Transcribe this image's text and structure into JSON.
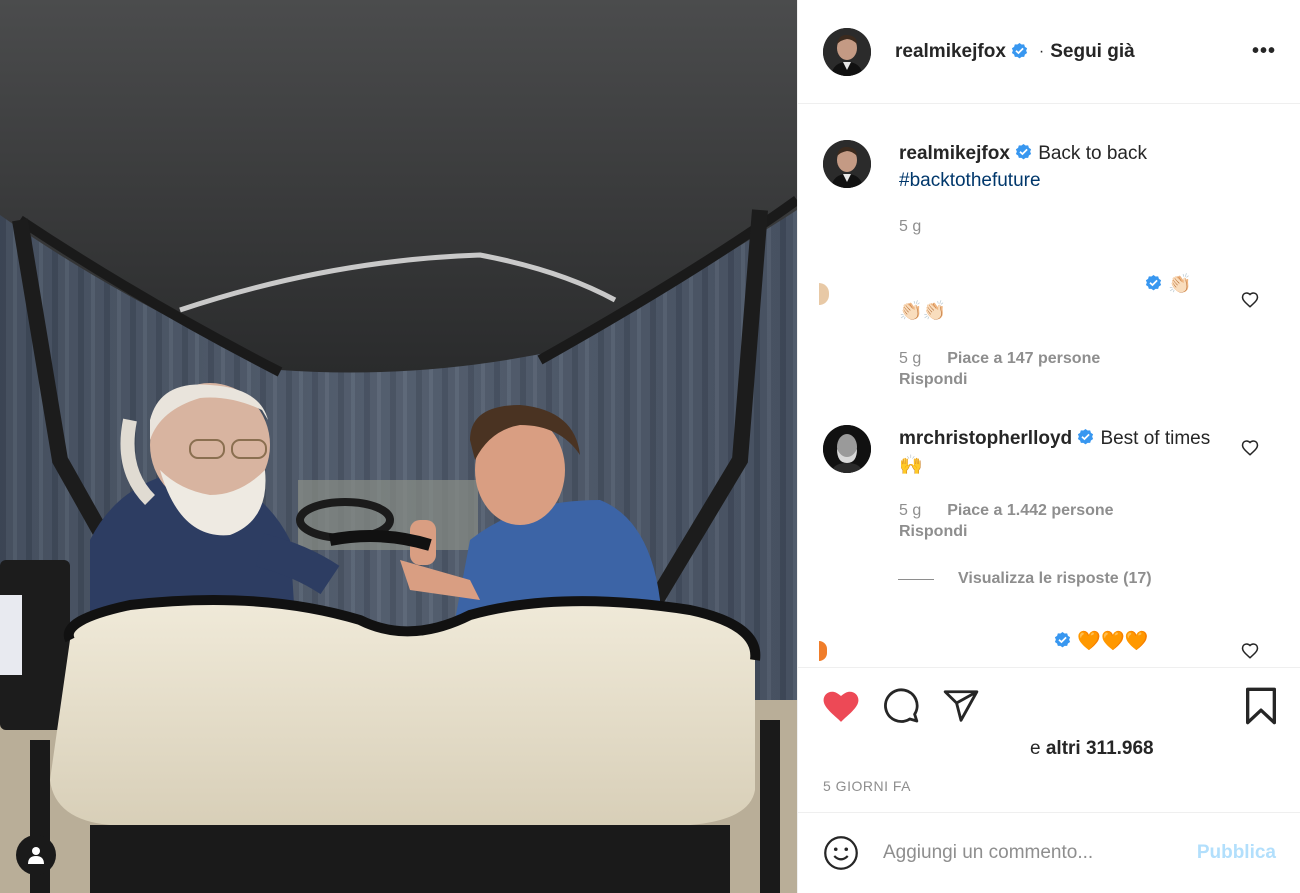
{
  "post": {
    "author": "realmikejfox",
    "follow_status": "Segui già",
    "dot": "·",
    "more": "•••"
  },
  "caption": {
    "username": "realmikejfox",
    "text": "Back to back",
    "hashtag": "#backtothefuture",
    "age": "5 g"
  },
  "comments": [
    {
      "username": "",
      "text": "👏🏻 👏🏻👏🏻",
      "age": "5 g",
      "likes": "Piace a 147 persone",
      "reply": "Rispondi"
    },
    {
      "username": "mrchristopherlloyd",
      "text": "Best of times 🙌",
      "age": "5 g",
      "likes": "Piace a 1.442 persone",
      "reply": "Rispondi",
      "view_replies": "Visualizza le risposte (17)"
    },
    {
      "username": "",
      "text": "🧡🧡🧡"
    }
  ],
  "actions": {
    "liked": true,
    "likes_prefix": "e ",
    "likes_count": "altri 311.968",
    "date": "5 GIORNI FA"
  },
  "add_comment": {
    "placeholder": "Aggiungi un commento...",
    "publish": "Pubblica"
  },
  "colors": {
    "like_red": "#ed4956",
    "verified_blue": "#3897f0",
    "hashtag_blue": "#00376b",
    "publish_disabled": "#b2dffc",
    "muted": "#8e8e8e"
  }
}
